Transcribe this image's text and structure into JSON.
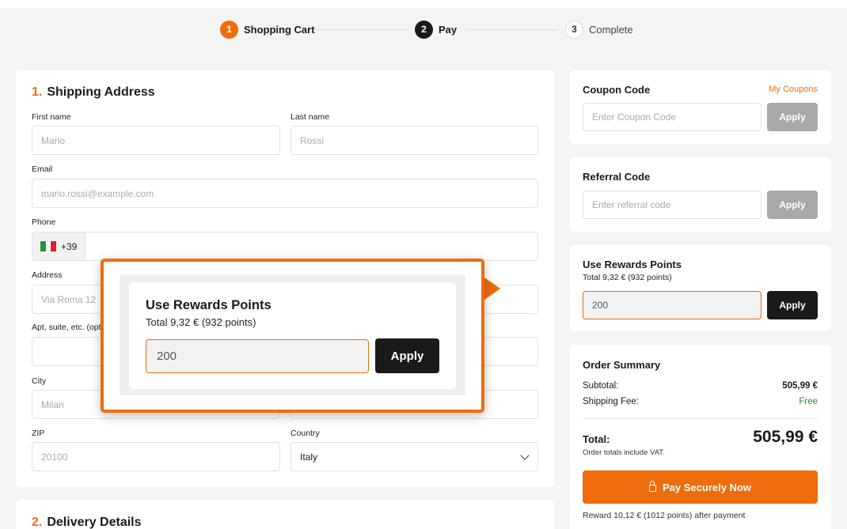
{
  "stepper": {
    "steps": [
      {
        "num": "1",
        "label": "Shopping Cart"
      },
      {
        "num": "2",
        "label": "Pay"
      },
      {
        "num": "3",
        "label": "Complete"
      }
    ]
  },
  "shipping": {
    "section_num": "1.",
    "title": "Shipping Address",
    "first_name": {
      "label": "First name",
      "placeholder": "Mario"
    },
    "last_name": {
      "label": "Last name",
      "placeholder": "Rossi"
    },
    "email": {
      "label": "Email",
      "placeholder": "mario.rossi@example.com"
    },
    "phone": {
      "label": "Phone",
      "prefix": "+39"
    },
    "address": {
      "label": "Address",
      "placeholder": "Via Roma 12"
    },
    "apt": {
      "label": "Apt, suite, etc. (optio"
    },
    "city": {
      "label": "City",
      "placeholder": "Milan"
    },
    "zip": {
      "label": "ZIP",
      "placeholder": "20100"
    },
    "country": {
      "label": "Country",
      "value": "Italy"
    }
  },
  "delivery": {
    "section_num": "2.",
    "title": "Delivery Details"
  },
  "coupon": {
    "title": "Coupon Code",
    "link": "My Coupons",
    "placeholder": "Enter Coupon Code",
    "button": "Apply"
  },
  "referral": {
    "title": "Referral Code",
    "placeholder": "Enter referral code",
    "button": "Apply"
  },
  "rewards": {
    "title": "Use Rewards Points",
    "subtitle": "Total 9,32 € (932 points)",
    "value": "200",
    "button": "Apply"
  },
  "summary": {
    "title": "Order Summary",
    "subtotal_label": "Subtotal:",
    "subtotal_value": "505,99 €",
    "shipping_label": "Shipping Fee:",
    "shipping_value": "Free",
    "total_label": "Total:",
    "total_value": "505,99 €",
    "vat_note": "Order totals include VAT.",
    "pay_button": "Pay Securely Now",
    "reward_note": "Reward 10,12 € (1012 points) after payment"
  },
  "callout": {
    "title": "Use Rewards Points",
    "subtitle": "Total 9,32 € (932 points)",
    "value": "200",
    "button": "Apply"
  },
  "colors": {
    "accent": "#ee6c0c",
    "dark": "#1a1a1a",
    "free": "#1f8a2e"
  }
}
